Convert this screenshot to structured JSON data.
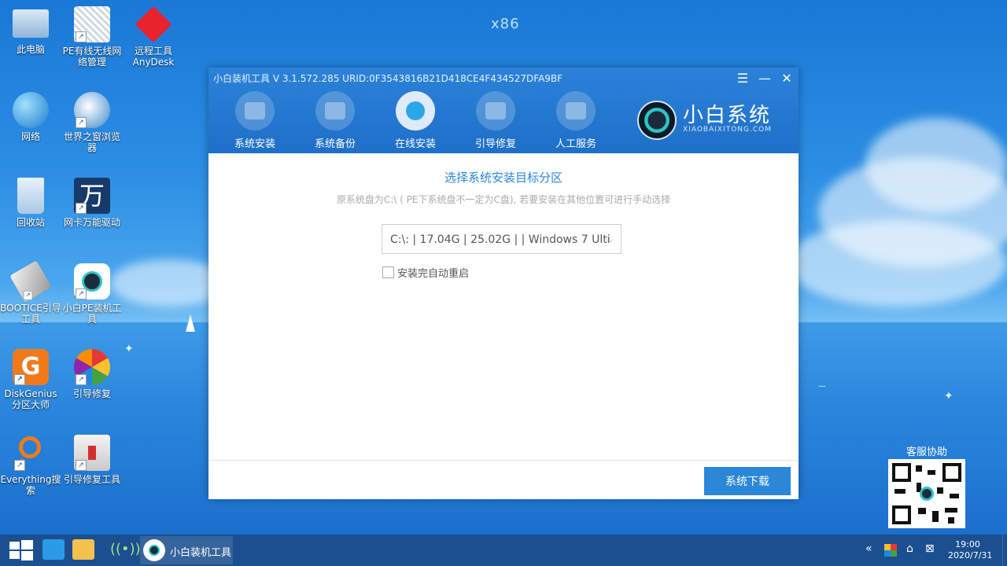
{
  "desktop": {
    "watermark": "x86",
    "icons": [
      {
        "label": "此电脑"
      },
      {
        "label": "PE有线无线网络管理"
      },
      {
        "label": "远程工具AnyDesk"
      },
      {
        "label": "网络"
      },
      {
        "label": "世界之窗浏览器"
      },
      {
        "label": "回收站"
      },
      {
        "label": "网卡万能驱动"
      },
      {
        "label": "BOOTICE引导工具"
      },
      {
        "label": "小白PE装机工具"
      },
      {
        "label": "DiskGenius分区大师"
      },
      {
        "label": "引导修复"
      },
      {
        "label": "Everything搜索"
      },
      {
        "label": "引导修复工具"
      }
    ],
    "support_label": "客服协助"
  },
  "window": {
    "title": "小白装机工具 V 3.1.572.285 URID:0F3543816B21D418CE4F434527DFA9BF",
    "tabs": [
      {
        "label": "系统安装"
      },
      {
        "label": "系统备份"
      },
      {
        "label": "在线安装"
      },
      {
        "label": "引导修复"
      },
      {
        "label": "人工服务"
      }
    ],
    "brand_name": "小白系统",
    "brand_url": "XIAOBAIXITONG.COM",
    "content_title": "选择系统安装目标分区",
    "content_subtitle": "原系统盘为C:\\ ( PE下系统盘不一定为C盘), 若要安装在其他位置可进行手动选择",
    "partition_selected": "C:\\: | 17.04G | 25.02G |  | Windows 7 Ulti",
    "auto_restart_label": "安装完自动重启",
    "download_button": "系统下载"
  },
  "taskbar": {
    "app_label": "小白装机工具",
    "time": "19:00",
    "date": "2020/7/31"
  }
}
